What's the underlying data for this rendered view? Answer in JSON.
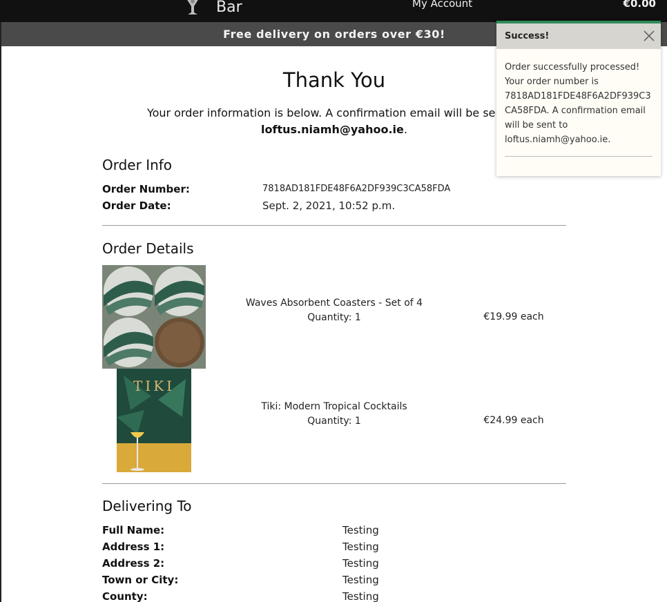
{
  "header": {
    "logo_text": "Bar",
    "account_label": "My Account",
    "bag_total": "€0.00"
  },
  "banner": {
    "text": "Free delivery on orders over €30!"
  },
  "page": {
    "title": "Thank You",
    "intro": "Your order information is below. A confirmation email will be sent to",
    "email": "loftus.niamh@yahoo.ie",
    "email_suffix": "."
  },
  "order_info": {
    "heading": "Order Info",
    "number_label": "Order Number:",
    "number_value": "7818AD181FDE48F6A2DF939C3CA58FDA",
    "date_label": "Order Date:",
    "date_value": "Sept. 2, 2021, 10:52 p.m."
  },
  "order_details": {
    "heading": "Order Details",
    "items": [
      {
        "name": "Waves Absorbent Coasters - Set of 4",
        "quantity": "Quantity: 1",
        "price": "€19.99 each"
      },
      {
        "name": "Tiki: Modern Tropical Cocktails",
        "quantity": "Quantity: 1",
        "price": "€24.99 each",
        "cover_text": "TIKI"
      }
    ]
  },
  "delivery": {
    "heading": "Delivering To",
    "rows": [
      {
        "label": "Full Name:",
        "value": "Testing"
      },
      {
        "label": "Address 1:",
        "value": "Testing"
      },
      {
        "label": "Address 2:",
        "value": "Testing"
      },
      {
        "label": "Town or City:",
        "value": "Testing"
      },
      {
        "label": "County:",
        "value": "Testing"
      }
    ]
  },
  "toast": {
    "title": "Success!",
    "message": "Order successfully processed! Your order number is 7818AD181FDE48F6A2DF939C3CA58FDA. A confirmation email will be sent to loftus.niamh@yahoo.ie.",
    "accent_color": "#2e8b57"
  }
}
